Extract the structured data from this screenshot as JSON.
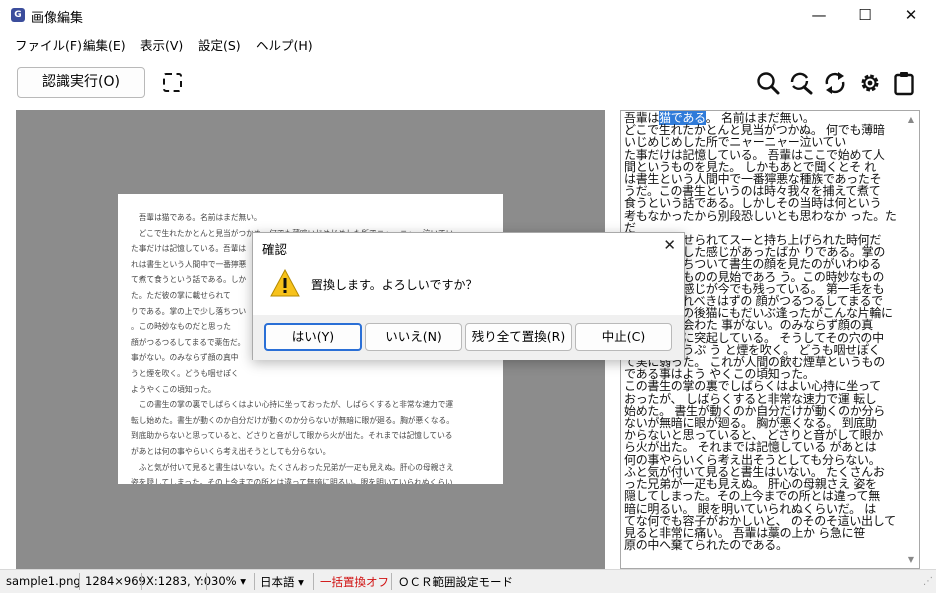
{
  "window": {
    "title": "画像編集",
    "app_icon_glyph": "G",
    "minimize_glyph": "—",
    "maximize_glyph": "☐",
    "close_glyph": "✕"
  },
  "menu": [
    {
      "label": "ファイル(F)"
    },
    {
      "label": "編集(E)"
    },
    {
      "label": "表示(V)"
    },
    {
      "label": "設定(S)"
    },
    {
      "label": "ヘルプ(H)"
    }
  ],
  "toolbar": {
    "ocr_button": "認識実行(O)",
    "icons": [
      "select-region-icon",
      "zoom-icon",
      "search-replace-icon",
      "refresh-icon",
      "settings-gear-icon",
      "clipboard-icon"
    ]
  },
  "document_image": {
    "text": "　吾輩は猫である。名前はまだ無い。\n　どこで生れたかとんと見当がつかぬ。何でも薄暗いじめじめした所でニャーニャー泣いてい\nた事だけは記憶している。吾輩は\nれは書生という人間中で一番獰悪\nて煮て食うという話である。しか\nた。ただ彼の掌に載せられて\nりである。掌の上で少し落ちつい\n。この時妙なものだと思った\n顔がつるつるしてまるで薬缶だ。\n事がない。のみならず顔の真中\nうと煙を吹く。どうも咽せぽく\nようやくこの頃知った。\n　この書生の掌の裏でしばらくはよい心持に坐っておったが、しばらくすると非常な速力で運\n転し始めた。書生が動くのか自分だけが動くのか分らないが無暗に眼が廻る。胸が悪くなる。\n到底助からないと思っていると、どさりと音がして眼から火が出た。それまでは記憶している\nがあとは何の事やらいくら考え出そうとしても分らない。\n　ふと気が付いて見ると書生はいない。たくさんおった兄弟が一疋も見えぬ。肝心の母親さえ\n姿を隠してしまった。その上今までの所とは違って無暗に明るい。眼を明いていられぬくらい\nだ。はてな何でも容子がおかしいと、のそのそ這い出して見ると非常に痛い。吾輩は藁の上か\nら急に笹原の中へ棄てられたのである。"
  },
  "text_panel": {
    "before_selection": "吾輩は",
    "selection": "猫である",
    "after_selection": "。 名前はまだ無い。\nどこで生れたかとんと見当がつかぬ。 何でも薄暗\nいじめじめした所でニャーニャー泣いてい\nた事だけは記憶している。 吾輩はここで始めて人\n間というものを見た。 しかもあとで聞くとそ れ\nは書生という人間中で一番獰悪な種族であったそ\nうだ。この書生というのは時々我々を捕えて煮て\n食うという話である。しかしその当時は何という\n考もなかったから別段恐しいとも思わなか った。ただ\n彼の掌に載せられてスーと持ち上げられた時何だ\nかフワフワした感じがあったばか りである。掌の\n上で少し落ちついて書生の顔を見たのがいわゆる\n人間というものの見始であろ う。この時妙なもの\nだと思った感じが今でも残っている。 第一毛をも\nって装飾されべきはずの 顔がつるつるしてまるで\n薬缶だ。その後猫にもだいぶ逢ったがこんな片輪に\nは一度も出会わた 事がない。のみならず顔の真\n中があまりに突起している。 そうしてその穴の中\nから時々ぷうぷ う と煙を吹く。 どうも咽せぽく\nて実に弱った。 これが人間の飲む煙草というもの\nである事はよう やくこの頃知った。\nこの書生の掌の裏でしばらくはよい心持に坐って\nおったが、 しばらくすると非常な速力で運 転し\n始めた。 書生が動くのか自分だけが動くのか分ら\nないが無暗に眼が廻る。 胸が悪くなる。 到底助\nからないと思っていると、 どさりと音がして眼か\nら火が出た。 それまでは記憶している があとは\n何の事やらいくら考え出そうとしても分らない。\nふと気が付いて見ると書生はいない。 たくさんお\nった兄弟が一疋も見えぬ。 肝心の母親さえ 姿を\n隠してしまった。その上今までの所とは違って無\n暗に明るい。 眼を明いていられぬくらいだ。 は\nてな何でも容子がおかしいと、 のそのそ這い出して\n見ると非常に痛い。 吾輩は藁の上か ら急に笹\n原の中へ棄てられたのである。"
  },
  "dialog": {
    "title": "確認",
    "close_glyph": "✕",
    "message": "置換します。よろしいですか？",
    "buttons": [
      "はい(Y)",
      "いいえ(N)",
      "残り全て置換(R)",
      "中止(C)"
    ]
  },
  "statusbar": {
    "filename": "sample1.png",
    "dimensions": "1284×969",
    "coords": "X:1283, Y:0",
    "zoom": "30% ▾",
    "language": "日本語 ▾",
    "replace_mode": "一括置換オフ",
    "ocr_mode": "ＯＣＲ範囲設定モード",
    "colors": {
      "replace_mode": "#d01010"
    }
  }
}
